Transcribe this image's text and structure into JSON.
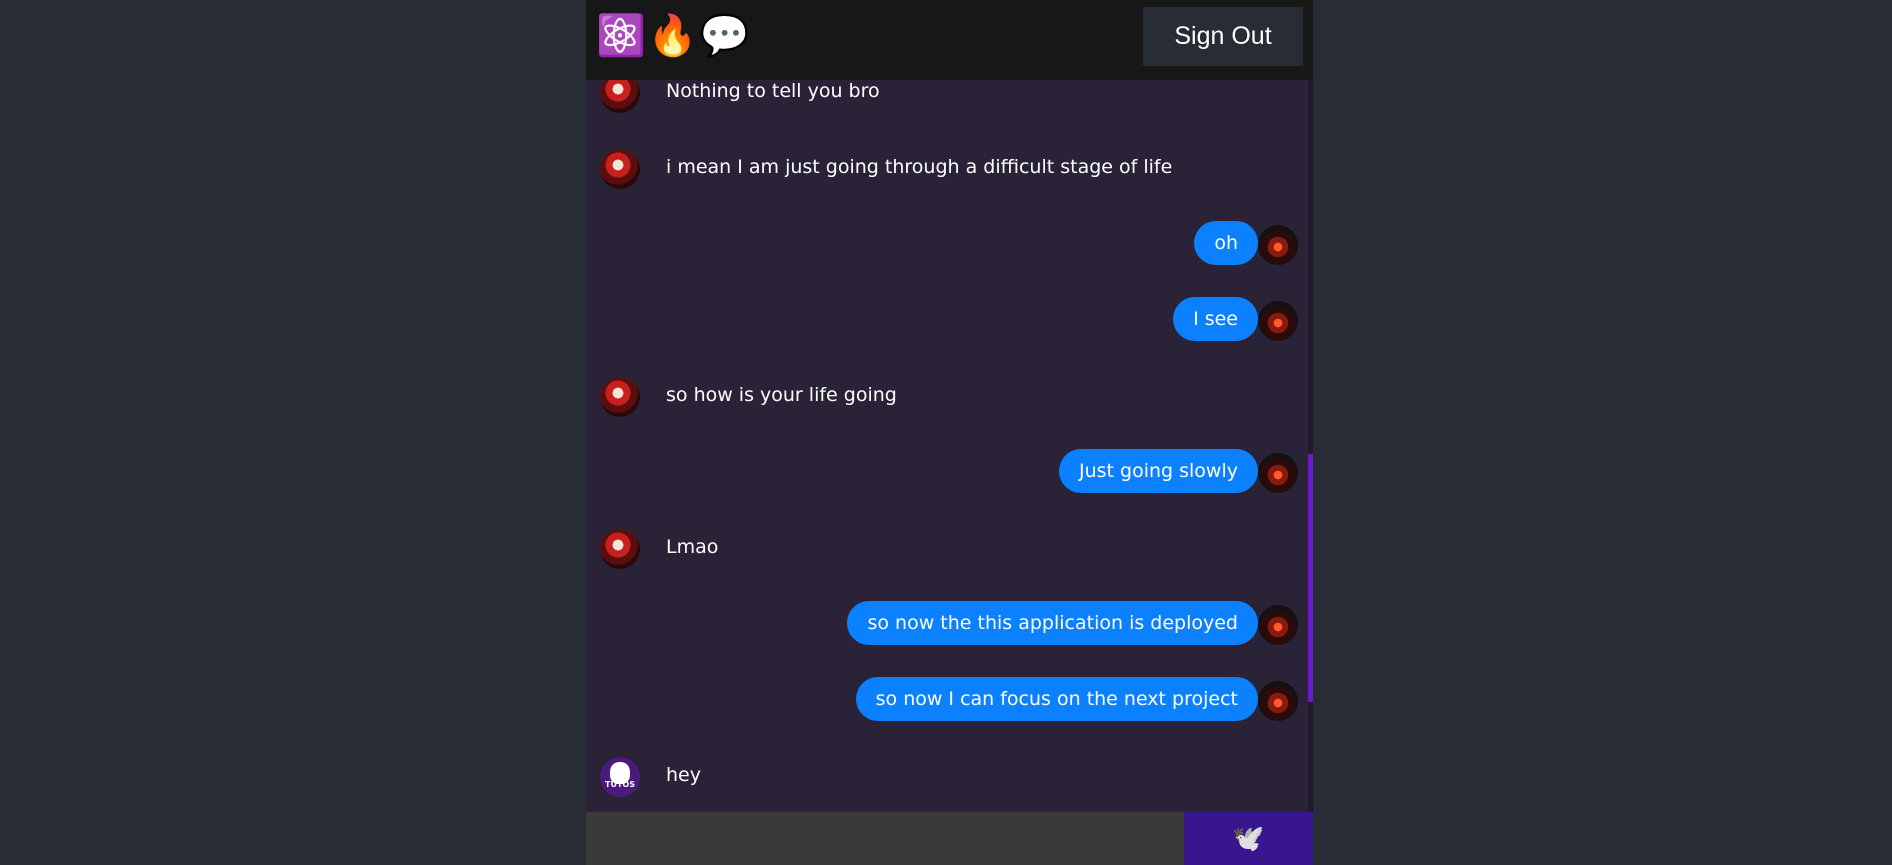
{
  "header": {
    "logo": "⚛️🔥💬",
    "signout_label": "Sign Out"
  },
  "messages": [
    {
      "type": "received",
      "text": "Nothing to tell you bro",
      "avatar": "red-anime-avatar"
    },
    {
      "type": "received",
      "text": "i mean I am just going through a difficult stage of life",
      "avatar": "red-anime-avatar"
    },
    {
      "type": "sent",
      "text": "oh",
      "avatar": "dark-monster-avatar"
    },
    {
      "type": "sent",
      "text": "I see",
      "avatar": "dark-monster-avatar"
    },
    {
      "type": "received",
      "text": "so how is your life going",
      "avatar": "red-anime-avatar"
    },
    {
      "type": "sent",
      "text": "Just going slowly",
      "avatar": "dark-monster-avatar"
    },
    {
      "type": "received",
      "text": "Lmao",
      "avatar": "red-anime-avatar"
    },
    {
      "type": "sent",
      "text": "so now the this application is deployed",
      "avatar": "dark-monster-avatar"
    },
    {
      "type": "sent",
      "text": "so now I can focus on the next project",
      "avatar": "dark-monster-avatar"
    },
    {
      "type": "received",
      "text": "hey",
      "avatar": "tutos-avatar",
      "avatar_text": "TUTOS"
    }
  ],
  "composer": {
    "value": "",
    "send_icon": "🕊️"
  },
  "colors": {
    "page_bg": "#282c34",
    "header_bg": "#181717",
    "chat_bg": "#2a2337",
    "sent_bubble": "#0b81ff",
    "send_button": "#38168f",
    "scroll_thumb": "#6a1bd1"
  }
}
